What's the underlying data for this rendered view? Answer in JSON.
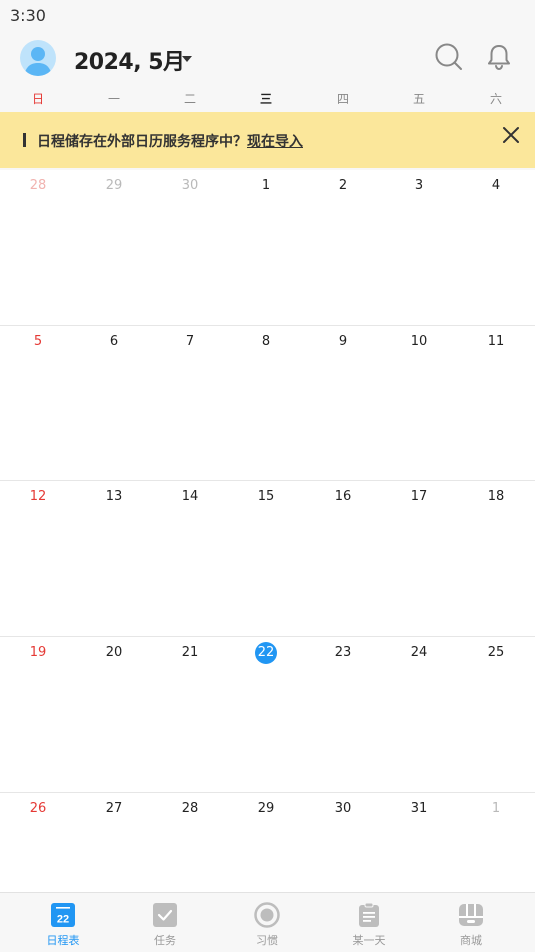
{
  "status_bar": {
    "time": "3:30"
  },
  "header": {
    "month_title": "2024, 5月"
  },
  "weekdays": [
    "日",
    "一",
    "二",
    "三",
    "四",
    "五",
    "六"
  ],
  "banner": {
    "message": "日程储存在外部日历服务程序中？",
    "link_label": "现在导入"
  },
  "calendar": {
    "weeks": [
      [
        "28",
        "29",
        "30",
        "1",
        "2",
        "3",
        "4"
      ],
      [
        "5",
        "6",
        "7",
        "8",
        "9",
        "10",
        "11"
      ],
      [
        "12",
        "13",
        "14",
        "15",
        "16",
        "17",
        "18"
      ],
      [
        "19",
        "20",
        "21",
        "22",
        "23",
        "24",
        "25"
      ],
      [
        "26",
        "27",
        "28",
        "29",
        "30",
        "31",
        "1"
      ]
    ],
    "today": "22"
  },
  "tabbar": {
    "items": [
      {
        "label": "日程表",
        "icon": "calendar-icon",
        "icon_text": "22"
      },
      {
        "label": "任务",
        "icon": "checkbox-icon"
      },
      {
        "label": "习惯",
        "icon": "habit-circle-icon"
      },
      {
        "label": "某一天",
        "icon": "clipboard-icon"
      },
      {
        "label": "商城",
        "icon": "store-icon"
      }
    ]
  },
  "colors": {
    "accent": "#2196f3",
    "sunday": "#e53935",
    "banner_bg": "#fbe79b",
    "inactive_tab": "#999999"
  }
}
